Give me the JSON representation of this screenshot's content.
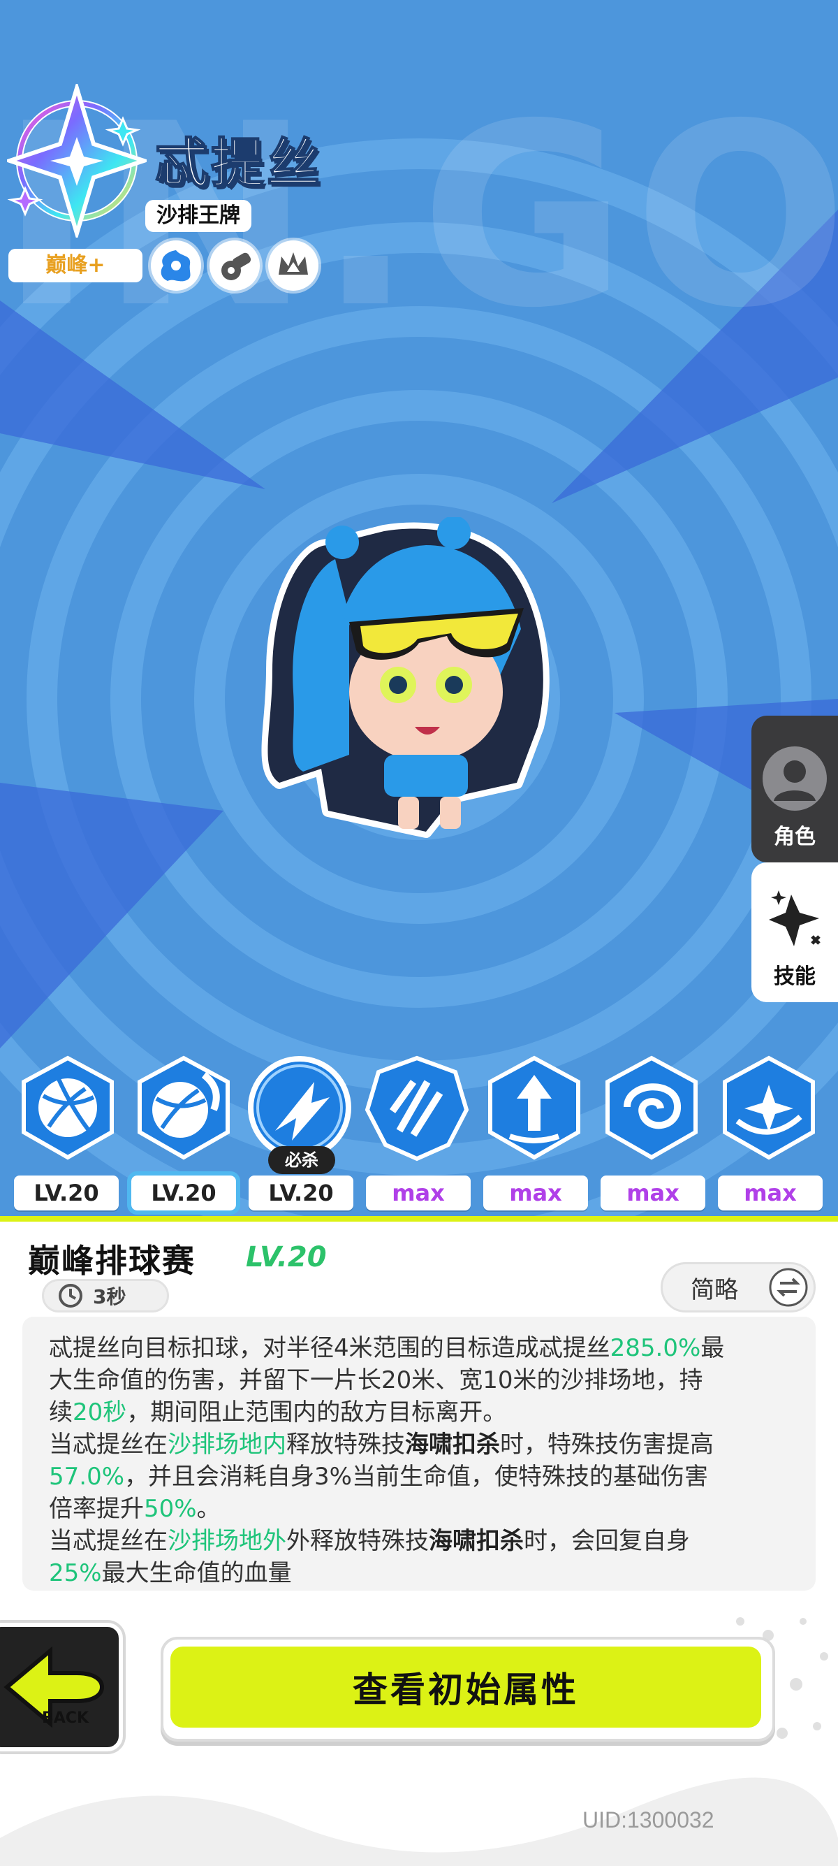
{
  "character": {
    "name": "忒提丝",
    "title": "沙排王牌",
    "rank": "巅峰+",
    "rank_emblem_icon": "rainbow-star-emblem-icon",
    "attribute_icons": [
      "blue-splash-icon",
      "cannon-icon",
      "crown-burst-icon"
    ]
  },
  "background": {
    "watermark": "IN.GOD"
  },
  "side_tabs": [
    {
      "label": "角色",
      "icon": "avatar-icon",
      "selected": false
    },
    {
      "label": "技能",
      "icon": "sparkle-star-icon",
      "selected": true
    }
  ],
  "skills": [
    {
      "icon": "volleyball-icon",
      "level": "LV.20",
      "selected": false
    },
    {
      "icon": "volleyball-splash-icon",
      "level": "LV.20",
      "selected": true
    },
    {
      "icon": "spike-strike-icon",
      "level": "LV.20",
      "selected": false,
      "badge": "必杀"
    },
    {
      "icon": "burst-slash-icon",
      "level": "max",
      "selected": false
    },
    {
      "icon": "arrow-up-icon",
      "level": "max",
      "selected": false
    },
    {
      "icon": "vortex-icon",
      "level": "max",
      "selected": false
    },
    {
      "icon": "swirl-star-icon",
      "level": "max",
      "selected": false
    }
  ],
  "skill_detail": {
    "name": "巅峰排球赛",
    "level": "LV.20",
    "cooldown": "3秒",
    "brief_toggle": "简略",
    "description_lines": [
      [
        {
          "t": "忒提丝向目标扣球，对半径4米范围的目标造成忒提丝"
        },
        {
          "t": "285.0%",
          "c": "green"
        },
        {
          "t": "最"
        }
      ],
      [
        {
          "t": "大生命值的伤害，并留下一片长20米、宽10米的沙排场地，持"
        }
      ],
      [
        {
          "t": "续"
        },
        {
          "t": "20秒",
          "c": "green"
        },
        {
          "t": "，期间阻止范围内的敌方目标离开。"
        }
      ],
      [
        {
          "t": "当忒提丝在"
        },
        {
          "t": "沙排场地内",
          "c": "green"
        },
        {
          "t": "释放特殊技"
        },
        {
          "t": "海啸扣杀",
          "c": "bold"
        },
        {
          "t": "时，特殊技伤害提高"
        }
      ],
      [
        {
          "t": "57.0%",
          "c": "green"
        },
        {
          "t": "，并且会消耗自身3%当前生命值，使特殊技的基础伤害"
        }
      ],
      [
        {
          "t": "倍率提升"
        },
        {
          "t": "50%",
          "c": "green"
        },
        {
          "t": "。"
        }
      ],
      [
        {
          "t": "当忒提丝在"
        },
        {
          "t": "沙排场地外",
          "c": "green"
        },
        {
          "t": "外释放特殊技"
        },
        {
          "t": "海啸扣杀",
          "c": "bold"
        },
        {
          "t": "时，会回复自身"
        }
      ],
      [
        {
          "t": "25%",
          "c": "green"
        },
        {
          "t": "最大生命值的血量"
        }
      ]
    ]
  },
  "buttons": {
    "back": "BACK",
    "view_attributes": "查看初始属性"
  },
  "footer": {
    "uid": "UID:1300032"
  },
  "colors": {
    "sky_blue": "#4d96dc",
    "lime": "#dcf215",
    "highlight_green": "#1ec47a",
    "max_purple": "#b040e8"
  }
}
